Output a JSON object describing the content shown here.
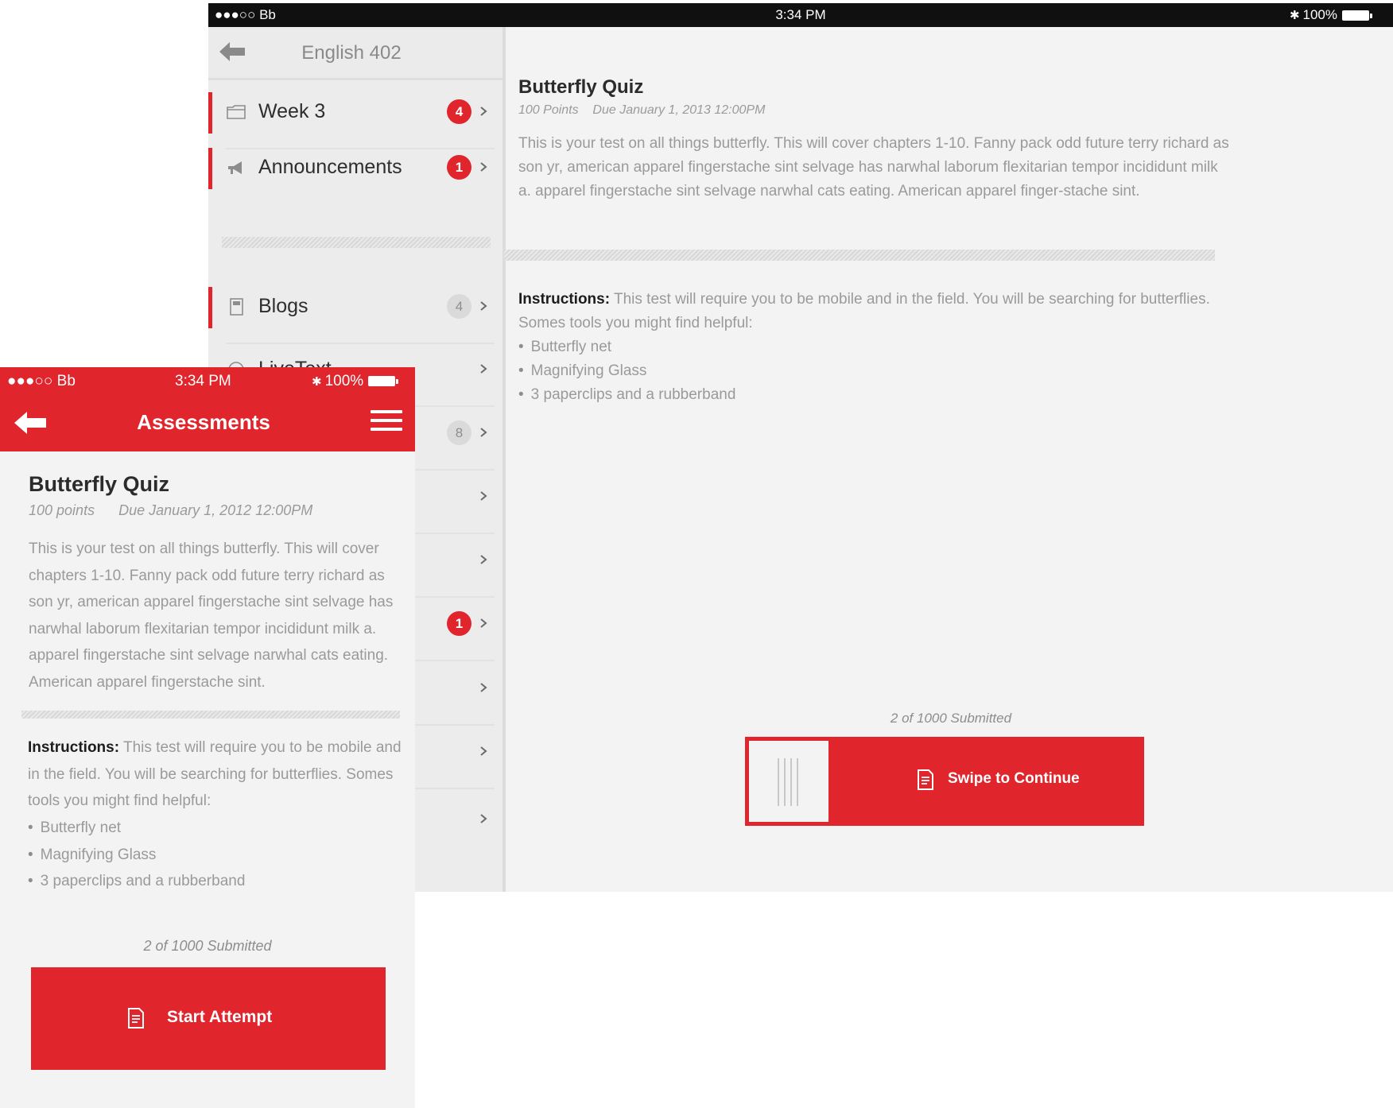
{
  "tablet": {
    "status": {
      "carrier": "●●●○○ Bb",
      "time": "3:34 PM",
      "battery": "100%"
    },
    "sidebar": {
      "title": "English 402",
      "items": [
        {
          "label": "Week 3",
          "badge": "4"
        },
        {
          "label": "Announcements",
          "badge": "1"
        },
        {
          "label": "Blogs",
          "badge": "4"
        },
        {
          "label": "LiveText",
          "badge": ""
        },
        {
          "label": "",
          "badge": "8"
        },
        {
          "label": "",
          "badge": ""
        },
        {
          "label": "",
          "badge": ""
        },
        {
          "label": "",
          "badge": "1"
        },
        {
          "label": "",
          "badge": ""
        },
        {
          "label": "",
          "badge": ""
        },
        {
          "label": "",
          "badge": ""
        }
      ]
    },
    "quiz": {
      "title": "Butterfly Quiz",
      "points": "100 Points",
      "due": "Due January 1, 2013  12:00PM",
      "description": "This is your test on all things butterfly. This will cover chapters 1-10. Fanny pack odd future terry richard as son yr, american apparel fingerstache sint selvage has narwhal laborum flexitarian tempor incididunt milk a. apparel fingerstache sint selvage narwhal cats eating. American apparel finger-stache sint.",
      "instructions_label": "Instructions:",
      "instructions_text": " This test will require you to be mobile and in the field. You will be searching for butterflies. Somes tools you might find helpful:",
      "tools": [
        "Butterfly net",
        "Magnifying Glass",
        "3 paperclips and a rubberband"
      ],
      "submitted": "2 of 1000 Submitted",
      "swipe_label": "Swipe to Continue"
    }
  },
  "phone": {
    "status": {
      "carrier": "●●●○○ Bb",
      "time": "3:34 PM",
      "battery": "100%"
    },
    "nav_title": "Assessments",
    "quiz": {
      "title": "Butterfly Quiz",
      "points": "100 points",
      "due": "Due  January 1, 2012 12:00PM",
      "description": "This is your test on all things butterfly. This will cover chapters 1-10. Fanny pack odd future terry richard as son yr, american apparel fingerstache sint selvage has narwhal laborum flexitarian tempor incididunt milk a. apparel fingerstache sint selvage narwhal cats eating. American apparel fingerstache sint.",
      "instructions_label": "Instructions:",
      "instructions_text": " This test will require you to be mobile and in the field. You will be searching for butterflies. Somes tools you might find helpful:",
      "tools": [
        "Butterfly net",
        "Magnifying Glass",
        "3 paperclips and a rubberband"
      ],
      "submitted": "2 of 1000 Submitted",
      "button_label": "Start Attempt"
    }
  },
  "colors": {
    "accent": "#e0252c",
    "text_muted": "#9a9a9a",
    "text_dark": "#2b2b2b"
  }
}
